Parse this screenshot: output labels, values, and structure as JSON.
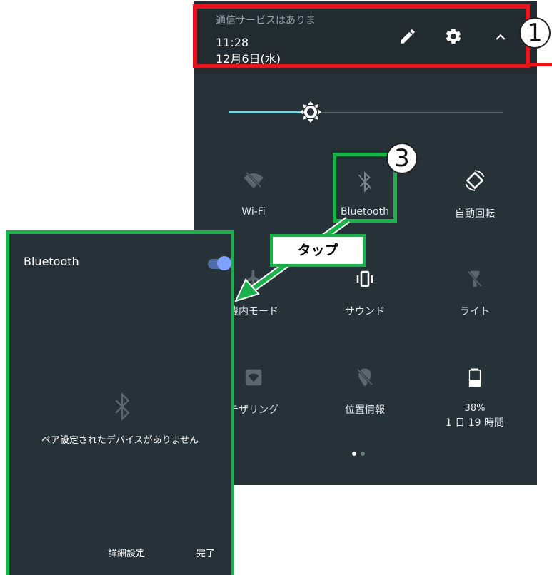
{
  "status": {
    "carrier": "通信サービスはありま",
    "time": "11:28",
    "date": "12月6日(水)"
  },
  "annotations": {
    "callout_1": "1",
    "callout_3": "3",
    "tap_label": "タップ"
  },
  "tiles": [
    {
      "label": "Wi-Fi",
      "icon": "wifi-off-icon"
    },
    {
      "label": "Bluetooth",
      "icon": "bluetooth-icon"
    },
    {
      "label": "自動回転",
      "icon": "auto-rotate-icon"
    },
    {
      "label": "機内モード",
      "icon": "airplane-icon"
    },
    {
      "label": "サウンド",
      "icon": "vibrate-icon"
    },
    {
      "label": "ライト",
      "icon": "flashlight-icon"
    },
    {
      "label": "テザリング",
      "icon": "tethering-icon"
    },
    {
      "label": "位置情報",
      "icon": "location-off-icon"
    },
    {
      "label": "38%",
      "sub": "1 日 19 時間",
      "icon": "battery-icon"
    }
  ],
  "brightness": 0.34,
  "pager": {
    "pages": 2,
    "current": 1
  },
  "dialog": {
    "title": "Bluetooth",
    "toggle_on": true,
    "empty_message": "ペア設定されたデバイスがありません",
    "advanced_button": "詳細設定",
    "done_button": "完了"
  },
  "colors": {
    "panel_bg": "#263238",
    "header_bg": "#212b30",
    "highlight_red": "#e8141b",
    "highlight_green": "#1ab04a",
    "slider_accent": "#7fd3de",
    "toggle_accent": "#7fa2ff"
  }
}
